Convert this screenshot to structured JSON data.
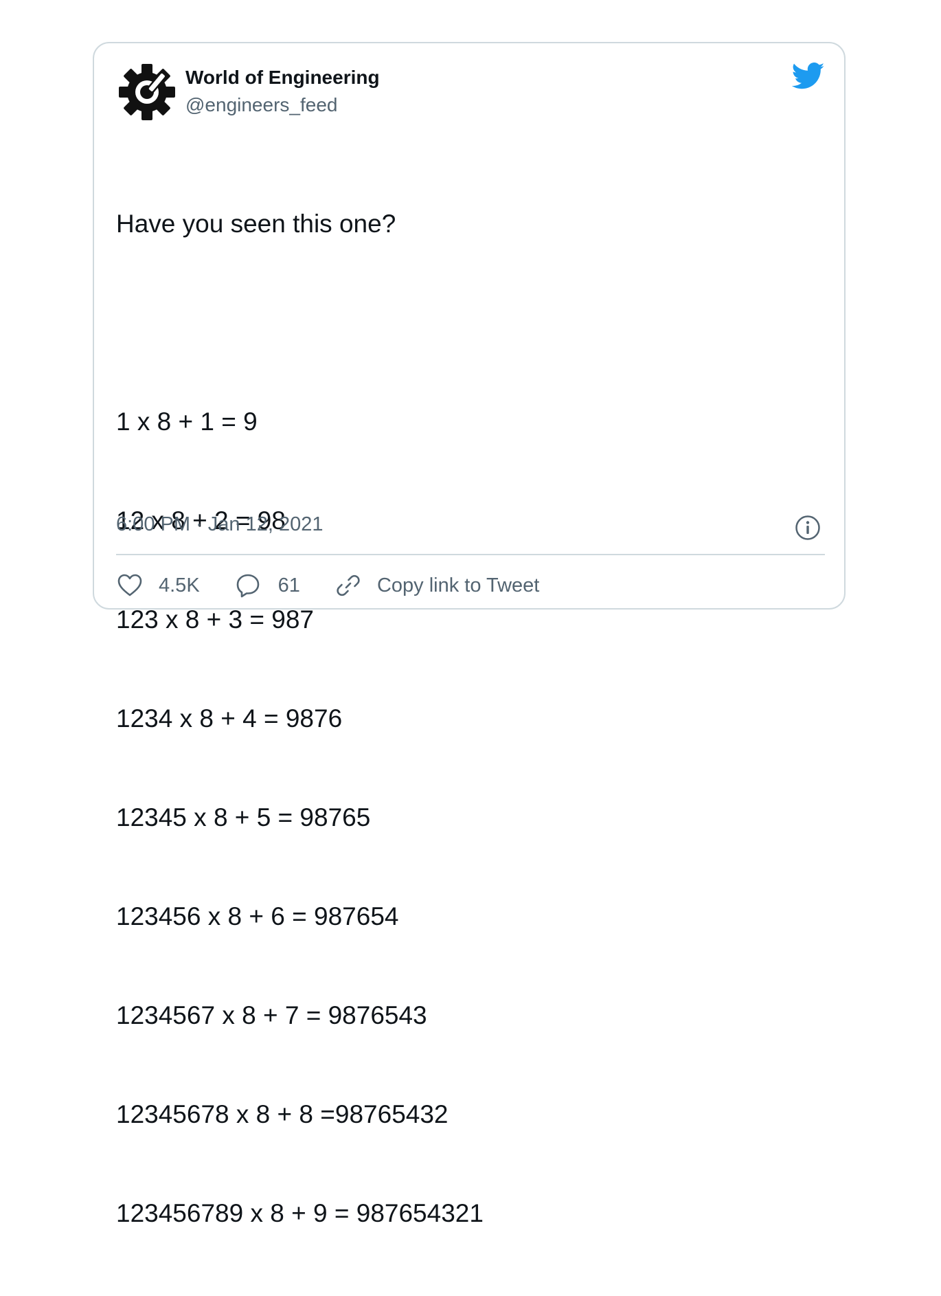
{
  "author": {
    "name": "World of Engineering",
    "handle": "@engineers_feed",
    "avatar_icon": "gear-wrench-icon"
  },
  "brand_icon": "twitter-bird-icon",
  "colors": {
    "brand": "#1d9bf0",
    "muted": "#536471",
    "text": "#0f1419",
    "border": "#cfd9de"
  },
  "tweet": {
    "lines": [
      "Have you seen this one?",
      "",
      "1 x 8 + 1 = 9",
      "12 x 8 + 2 = 98",
      "123 x 8 + 3 = 987",
      "1234 x 8 + 4 = 9876",
      "12345 x 8 + 5 = 98765",
      "123456 x 8 + 6 = 987654",
      "1234567 x 8 + 7 = 9876543",
      "12345678 x 8 + 8 =98765432",
      "123456789 x 8 + 9 = 987654321"
    ]
  },
  "timestamp": "6:00 PM · Jan 12, 2021",
  "actions": {
    "like_count": "4.5K",
    "reply_count": "61",
    "copy_link_label": "Copy link to Tweet"
  }
}
